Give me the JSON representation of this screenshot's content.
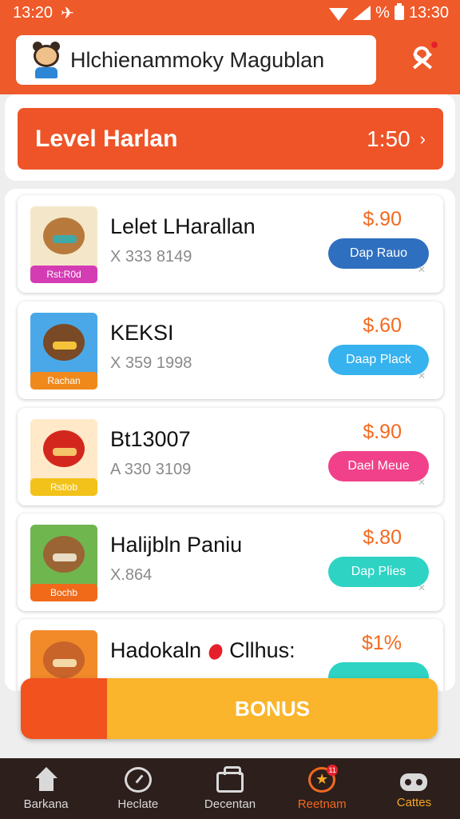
{
  "status_bar": {
    "time": "13:20",
    "right_text": "%",
    "right_time": "13:30"
  },
  "header": {
    "search_text": "Hlchienammoky Magublan",
    "mascot_icon": "mascot-icon",
    "profile_icon": "profile-icon"
  },
  "level": {
    "title": "Level Harlan",
    "time": "1:50",
    "chevron": "›"
  },
  "items": [
    {
      "title": "Lelet LHarallan",
      "sub": "X 333  8149",
      "price": "$.90",
      "button": "Dap Rauo",
      "tag": "Rst:R0d",
      "btn_color": "#2f6fbf",
      "tag_color": "#d43cb4",
      "thumb_bg": "#f4e7c9",
      "thumb_shape": "#b87a3c",
      "thumb_shape2": "#3fa9a8"
    },
    {
      "title": "KEKSI",
      "sub": "X 359  1998",
      "price": "$.60",
      "button": "Daap Plack",
      "tag": "Rachan",
      "btn_color": "#36b2ee",
      "tag_color": "#f0891c",
      "thumb_bg": "#4aa8e8",
      "thumb_shape": "#7a4a26",
      "thumb_shape2": "#f5c33a"
    },
    {
      "title": "Bt13007",
      "sub": "A 330  3109",
      "price": "$.90",
      "button": "Dael Meue",
      "tag": "Rstlob",
      "btn_color": "#f0418a",
      "tag_color": "#f2c21a",
      "thumb_bg": "#ffe9c8",
      "thumb_shape": "#d3271e",
      "thumb_shape2": "#f4c36a"
    },
    {
      "title": "Halijbln Paniu",
      "sub": "X.864",
      "price": "$.80",
      "button": "Dap Plies",
      "tag": "Bochb",
      "btn_color": "#2ed3c4",
      "tag_color": "#f06a1a",
      "thumb_bg": "#6fb64e",
      "thumb_shape": "#9b6434",
      "thumb_shape2": "#e8dcc4"
    },
    {
      "title_a": "Hadokaln",
      "title_b": "Cllhus:",
      "sub": "",
      "price": "$1%",
      "button": "",
      "tag": "",
      "btn_color": "#2ed3c4",
      "tag_color": "#f06a1a",
      "thumb_bg": "#f28a2a",
      "thumb_shape": "#c8632a",
      "thumb_shape2": "#f4d9a8"
    }
  ],
  "corner_mark": "✕",
  "bonus": {
    "label": "BONUS"
  },
  "nav": [
    {
      "label": "Barkana",
      "icon": "home-icon"
    },
    {
      "label": "Heclate",
      "icon": "gauge-icon"
    },
    {
      "label": "Decentan",
      "icon": "box-icon"
    },
    {
      "label": "Reetnam",
      "icon": "star-icon",
      "badge": "11"
    },
    {
      "label": "Cattes",
      "icon": "game-icon"
    }
  ],
  "colors": {
    "brand": "#ef5a2a",
    "price": "#f26a1f",
    "nav_bg": "#2c1f1c"
  }
}
